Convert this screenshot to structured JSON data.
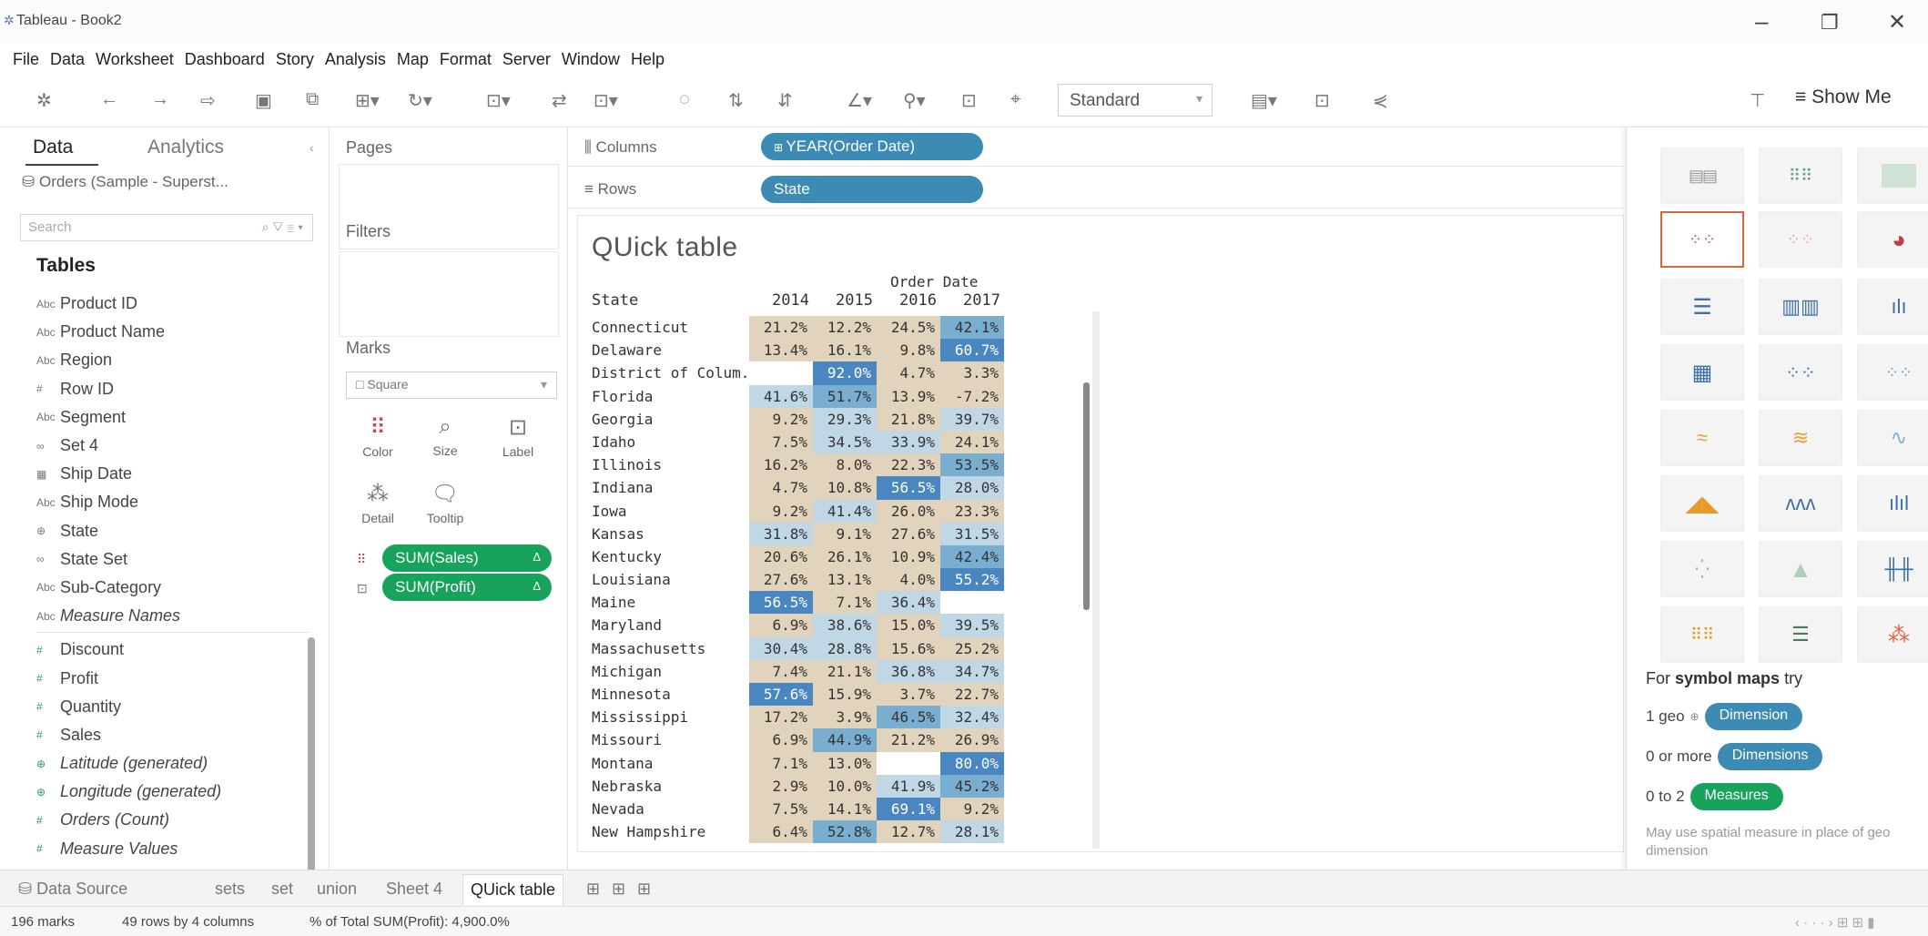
{
  "window": {
    "title": "Tableau - Book2"
  },
  "menu": [
    "File",
    "Data",
    "Worksheet",
    "Dashboard",
    "Story",
    "Analysis",
    "Map",
    "Format",
    "Server",
    "Window",
    "Help"
  ],
  "toolbar": {
    "fit_select": "Standard",
    "show_me": "Show Me"
  },
  "data_pane": {
    "tabs": [
      "Data",
      "Analytics"
    ],
    "datasource": "Orders (Sample - Superst...",
    "search_placeholder": "Search",
    "tables_header": "Tables",
    "dimensions": [
      {
        "label": "Product ID",
        "icon": "Abc"
      },
      {
        "label": "Product Name",
        "icon": "Abc"
      },
      {
        "label": "Region",
        "icon": "Abc"
      },
      {
        "label": "Row ID",
        "icon": "#"
      },
      {
        "label": "Segment",
        "icon": "Abc"
      },
      {
        "label": "Set 4",
        "icon": "∞"
      },
      {
        "label": "Ship Date",
        "icon": "▦"
      },
      {
        "label": "Ship Mode",
        "icon": "Abc"
      },
      {
        "label": "State",
        "icon": "⊕"
      },
      {
        "label": "State Set",
        "icon": "∞"
      },
      {
        "label": "Sub-Category",
        "icon": "Abc"
      },
      {
        "label": "Measure Names",
        "icon": "Abc",
        "italic": true
      }
    ],
    "measures": [
      {
        "label": "Discount",
        "icon": "#"
      },
      {
        "label": "Profit",
        "icon": "#"
      },
      {
        "label": "Quantity",
        "icon": "#"
      },
      {
        "label": "Sales",
        "icon": "#"
      },
      {
        "label": "Latitude (generated)",
        "icon": "⊕",
        "italic": true
      },
      {
        "label": "Longitude (generated)",
        "icon": "⊕",
        "italic": true
      },
      {
        "label": "Orders (Count)",
        "icon": "#",
        "italic": true
      },
      {
        "label": "Measure Values",
        "icon": "#",
        "italic": true
      }
    ]
  },
  "cards": {
    "pages": "Pages",
    "filters": "Filters",
    "marks": "Marks",
    "mark_type": "Square",
    "mark_buttons": [
      "Color",
      "Size",
      "Label",
      "Detail",
      "Tooltip"
    ],
    "mark_pills": [
      "SUM(Sales)",
      "SUM(Profit)"
    ],
    "mark_pill_flag": "Δ"
  },
  "shelves": {
    "columns_label": "Columns",
    "rows_label": "Rows",
    "columns_pill": "YEAR(Order Date)",
    "rows_pill": "State"
  },
  "viz": {
    "title": "QUick table",
    "column_header": "Order Date",
    "row_header": "State",
    "years": [
      "2014",
      "2015",
      "2016",
      "2017"
    ],
    "rows": [
      {
        "state": "Connecticut",
        "v": [
          "21.2%",
          "12.2%",
          "24.5%",
          "42.1%"
        ],
        "s": [
          21.2,
          12.2,
          24.5,
          42.1
        ]
      },
      {
        "state": "Delaware",
        "v": [
          "13.4%",
          "16.1%",
          "9.8%",
          "60.7%"
        ],
        "s": [
          13.4,
          16.1,
          9.8,
          60.7
        ]
      },
      {
        "state": "District of Colum..",
        "v": [
          "",
          "92.0%",
          "4.7%",
          "3.3%"
        ],
        "s": [
          null,
          92.0,
          4.7,
          3.3
        ]
      },
      {
        "state": "Florida",
        "v": [
          "41.6%",
          "51.7%",
          "13.9%",
          "-7.2%"
        ],
        "s": [
          41.6,
          51.7,
          13.9,
          -7.2
        ]
      },
      {
        "state": "Georgia",
        "v": [
          "9.2%",
          "29.3%",
          "21.8%",
          "39.7%"
        ],
        "s": [
          9.2,
          29.3,
          21.8,
          39.7
        ]
      },
      {
        "state": "Idaho",
        "v": [
          "7.5%",
          "34.5%",
          "33.9%",
          "24.1%"
        ],
        "s": [
          7.5,
          34.5,
          33.9,
          24.1
        ]
      },
      {
        "state": "Illinois",
        "v": [
          "16.2%",
          "8.0%",
          "22.3%",
          "53.5%"
        ],
        "s": [
          16.2,
          8.0,
          22.3,
          53.5
        ]
      },
      {
        "state": "Indiana",
        "v": [
          "4.7%",
          "10.8%",
          "56.5%",
          "28.0%"
        ],
        "s": [
          4.7,
          10.8,
          56.5,
          28.0
        ]
      },
      {
        "state": "Iowa",
        "v": [
          "9.2%",
          "41.4%",
          "26.0%",
          "23.3%"
        ],
        "s": [
          9.2,
          41.4,
          26.0,
          23.3
        ]
      },
      {
        "state": "Kansas",
        "v": [
          "31.8%",
          "9.1%",
          "27.6%",
          "31.5%"
        ],
        "s": [
          31.8,
          9.1,
          27.6,
          31.5
        ]
      },
      {
        "state": "Kentucky",
        "v": [
          "20.6%",
          "26.1%",
          "10.9%",
          "42.4%"
        ],
        "s": [
          20.6,
          26.1,
          10.9,
          42.4
        ]
      },
      {
        "state": "Louisiana",
        "v": [
          "27.6%",
          "13.1%",
          "4.0%",
          "55.2%"
        ],
        "s": [
          27.6,
          13.1,
          4.0,
          55.2
        ]
      },
      {
        "state": "Maine",
        "v": [
          "56.5%",
          "7.1%",
          "36.4%",
          ""
        ],
        "s": [
          56.5,
          7.1,
          36.4,
          null
        ]
      },
      {
        "state": "Maryland",
        "v": [
          "6.9%",
          "38.6%",
          "15.0%",
          "39.5%"
        ],
        "s": [
          6.9,
          38.6,
          15.0,
          39.5
        ]
      },
      {
        "state": "Massachusetts",
        "v": [
          "30.4%",
          "28.8%",
          "15.6%",
          "25.2%"
        ],
        "s": [
          30.4,
          28.8,
          15.6,
          25.2
        ]
      },
      {
        "state": "Michigan",
        "v": [
          "7.4%",
          "21.1%",
          "36.8%",
          "34.7%"
        ],
        "s": [
          7.4,
          21.1,
          36.8,
          34.7
        ]
      },
      {
        "state": "Minnesota",
        "v": [
          "57.6%",
          "15.9%",
          "3.7%",
          "22.7%"
        ],
        "s": [
          57.6,
          15.9,
          3.7,
          22.7
        ]
      },
      {
        "state": "Mississippi",
        "v": [
          "17.2%",
          "3.9%",
          "46.5%",
          "32.4%"
        ],
        "s": [
          17.2,
          3.9,
          46.5,
          32.4
        ]
      },
      {
        "state": "Missouri",
        "v": [
          "6.9%",
          "44.9%",
          "21.2%",
          "26.9%"
        ],
        "s": [
          6.9,
          44.9,
          21.2,
          26.9
        ]
      },
      {
        "state": "Montana",
        "v": [
          "7.1%",
          "13.0%",
          "",
          "80.0%"
        ],
        "s": [
          7.1,
          13.0,
          null,
          80.0
        ]
      },
      {
        "state": "Nebraska",
        "v": [
          "2.9%",
          "10.0%",
          "41.9%",
          "45.2%"
        ],
        "s": [
          2.9,
          10.0,
          41.9,
          45.2
        ]
      },
      {
        "state": "Nevada",
        "v": [
          "7.5%",
          "14.1%",
          "69.1%",
          "9.2%"
        ],
        "s": [
          7.5,
          14.1,
          69.1,
          9.2
        ]
      },
      {
        "state": "New Hampshire",
        "v": [
          "6.4%",
          "52.8%",
          "12.7%",
          "28.1%"
        ],
        "s": [
          6.4,
          52.8,
          12.7,
          28.1
        ]
      }
    ],
    "colors": {
      "low": "#e2d3bc",
      "mid": "#c0d8e6",
      "high": "#7aaed0",
      "max": "#4a86c0"
    }
  },
  "showme": {
    "hint_prefix": "For ",
    "hint_bold": "symbol maps",
    "hint_suffix": " try",
    "req1_prefix": "1 geo",
    "req1_pill": "Dimension",
    "req2_prefix": "0 or more",
    "req2_pill": "Dimensions",
    "req3_prefix": "0 to 2",
    "req3_pill": "Measures",
    "note": "May use spatial measure in place of geo dimension"
  },
  "sheet_tabs": {
    "datasource": "Data Source",
    "sheets": [
      "sets",
      "set",
      "union",
      "Sheet 4",
      "QUick table"
    ]
  },
  "status": {
    "marks": "196 marks",
    "dims": "49 rows by 4 columns",
    "total": "% of Total SUM(Profit): 4,900.0%"
  }
}
